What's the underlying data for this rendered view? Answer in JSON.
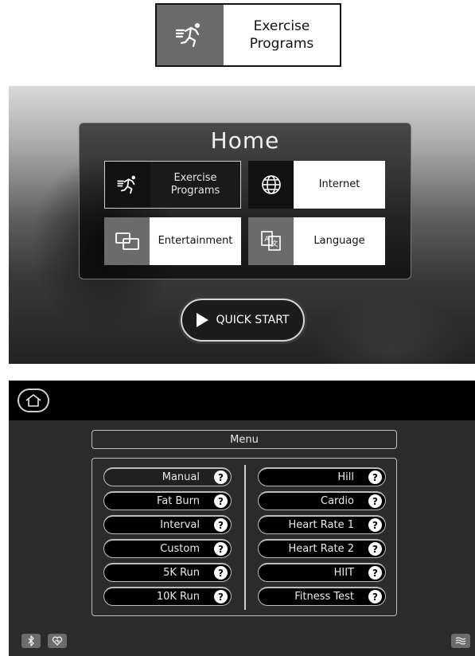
{
  "callout": {
    "label": "Exercise\nPrograms",
    "icon": "runner-icon"
  },
  "home": {
    "title": "Home",
    "tiles": [
      {
        "label": "Exercise\nPrograms",
        "icon": "runner-icon"
      },
      {
        "label": "Internet",
        "icon": "globe-icon"
      },
      {
        "label": "Entertainment",
        "icon": "screens-icon"
      },
      {
        "label": "Language",
        "icon": "translate-icon"
      }
    ],
    "quick_start": "QUICK START"
  },
  "menu": {
    "title": "Menu",
    "left": [
      "Manual",
      "Fat Burn",
      "Interval",
      "Custom",
      "5K Run",
      "10K Run"
    ],
    "right": [
      "Hill",
      "Cardio",
      "Heart Rate 1",
      "Heart Rate 2",
      "HIIT",
      "Fitness Test"
    ],
    "help_glyph": "?",
    "status": {
      "bluetooth": "bluetooth-icon",
      "heart": "heart-icon",
      "menu": "wave-icon"
    }
  }
}
